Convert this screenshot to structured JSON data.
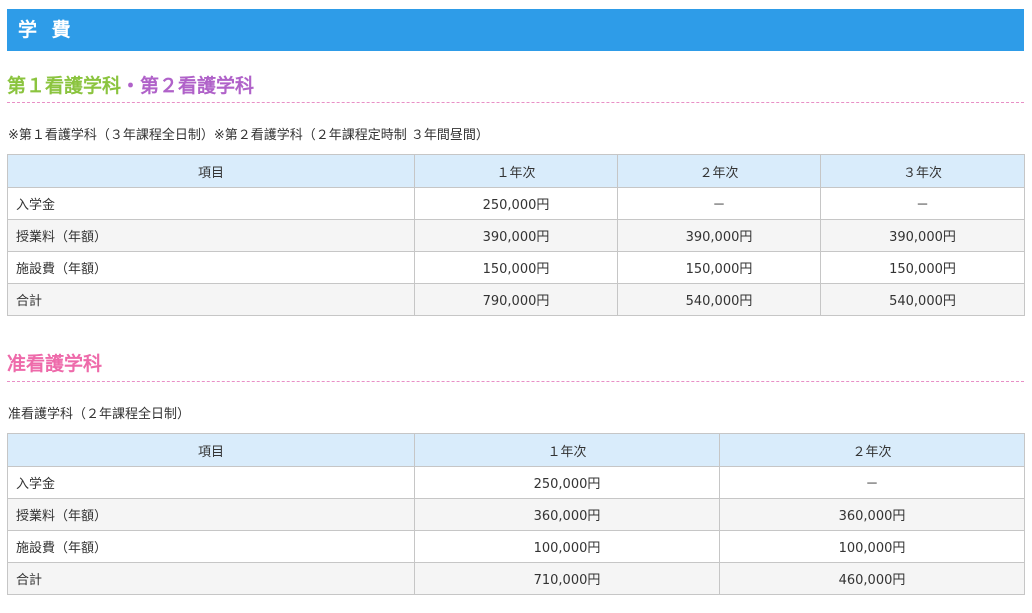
{
  "header": {
    "title": "学 費"
  },
  "section1": {
    "title_part1": "第１看護学科",
    "title_sep": "・",
    "title_part2": "第２看護学科",
    "note": "※第１看護学科（３年課程全日制）※第２看護学科（２年課程定時制 ３年間昼間）",
    "table": {
      "headers": [
        "項目",
        "１年次",
        "２年次",
        "３年次"
      ],
      "rows": [
        [
          "入学金",
          "250,000円",
          "－",
          "－"
        ],
        [
          "授業料（年額）",
          "390,000円",
          "390,000円",
          "390,000円"
        ],
        [
          "施設費（年額）",
          "150,000円",
          "150,000円",
          "150,000円"
        ],
        [
          "合計",
          "790,000円",
          "540,000円",
          "540,000円"
        ]
      ]
    }
  },
  "section2": {
    "title": "准看護学科",
    "note": "准看護学科（２年課程全日制）",
    "table": {
      "headers": [
        "項目",
        "１年次",
        "２年次"
      ],
      "rows": [
        [
          "入学金",
          "250,000円",
          "－"
        ],
        [
          "授業料（年額）",
          "360,000円",
          "360,000円"
        ],
        [
          "施設費（年額）",
          "100,000円",
          "100,000円"
        ],
        [
          "合計",
          "710,000円",
          "460,000円"
        ]
      ]
    }
  }
}
